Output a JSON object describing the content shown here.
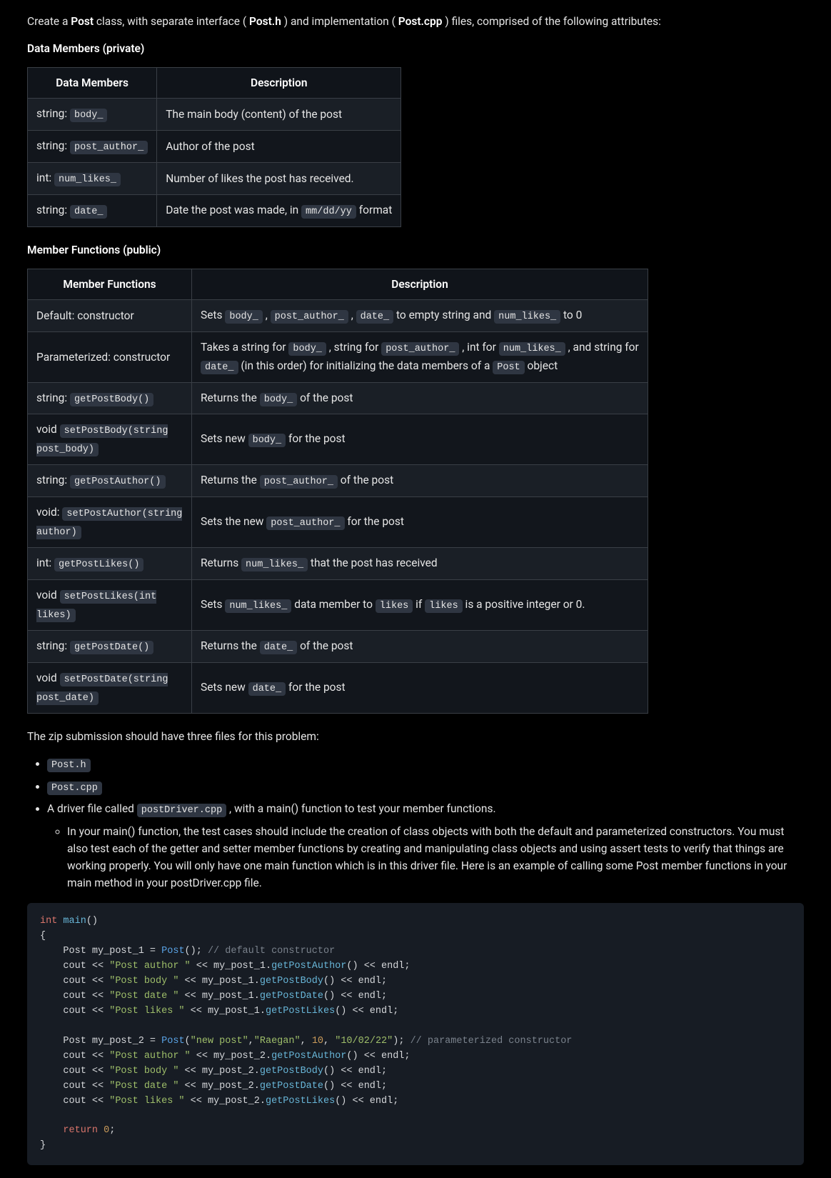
{
  "intro": {
    "t1": "Create a ",
    "t2": "Post",
    "t3": " class, with separate interface (",
    "t4": "Post.h",
    "t5": ") and implementation (",
    "t6": "Post.cpp",
    "t7": ") files, comprised of the following attributes:"
  },
  "dm_heading": "Data Members (private)",
  "dm_head": {
    "c1": "Data Members",
    "c2": "Description"
  },
  "dm": {
    "r0": {
      "p": "string: ",
      "c": "body_",
      "d": "The main body (content) of the post"
    },
    "r1": {
      "p": "string: ",
      "c": "post_author_",
      "d": "Author of the post"
    },
    "r2": {
      "p": "int: ",
      "c": "num_likes_",
      "d": "Number of likes the post has received."
    },
    "r3": {
      "p": "string: ",
      "c": "date_",
      "d1": "Date the post was made, in ",
      "dc": "mm/dd/yy",
      "d2": " format"
    }
  },
  "mf_heading": "Member Functions (public)",
  "mf_head": {
    "c1": "Member Functions",
    "c2": "Description"
  },
  "mf": {
    "r0": {
      "left": "Default: constructor",
      "d1": "Sets ",
      "c1": "body_",
      "d2": " , ",
      "c2": "post_author_",
      "d3": " , ",
      "c3": "date_",
      "d4": " to empty string and ",
      "c4": "num_likes_",
      "d5": " to 0"
    },
    "r1": {
      "left": "Parameterized: constructor",
      "d1": "Takes a string for ",
      "c1": "body_",
      "d2": " , string for ",
      "c2": "post_author_",
      "d3": " , int for ",
      "c3": "num_likes_",
      "d4": " , and string for ",
      "c4": "date_",
      "d5": " (in this order) for initializing the data members of a ",
      "c5": "Post",
      "d6": " object"
    },
    "r2": {
      "lp": "string: ",
      "lc": "getPostBody()",
      "d1": "Returns the ",
      "c1": "body_",
      "d2": " of the post"
    },
    "r3": {
      "lp": "void ",
      "lc": "setPostBody(string post_body)",
      "d1": "Sets new ",
      "c1": "body_",
      "d2": " for the post"
    },
    "r4": {
      "lp": "string: ",
      "lc": "getPostAuthor()",
      "d1": "Returns the ",
      "c1": "post_author_",
      "d2": " of the post"
    },
    "r5": {
      "lp": "void: ",
      "lc": "setPostAuthor(string author)",
      "d1": "Sets the new ",
      "c1": "post_author_",
      "d2": " for the post"
    },
    "r6": {
      "lp": "int: ",
      "lc": "getPostLikes()",
      "d1": "Returns ",
      "c1": "num_likes_",
      "d2": " that the post has received"
    },
    "r7": {
      "lp": "void ",
      "lc": "setPostLikes(int likes)",
      "d1": "Sets ",
      "c1": "num_likes_",
      "d2": " data member to ",
      "c2": "likes",
      "d3": " if ",
      "c3": "likes",
      "d4": " is a positive integer or 0."
    },
    "r8": {
      "lp": "string: ",
      "lc": "getPostDate()",
      "d1": "Returns the ",
      "c1": "date_",
      "d2": " of the post"
    },
    "r9": {
      "lp": "void ",
      "lc": "setPostDate(string post_date)",
      "d1": "Sets new ",
      "c1": "date_",
      "d2": " for the post"
    }
  },
  "zip_line": "The zip submission should have three files for this problem:",
  "files": {
    "f0": "Post.h",
    "f1": "Post.cpp",
    "f2_pre": "A driver file called ",
    "f2_code": "postDriver.cpp",
    "f2_post": " , with a main() function to test your member functions.",
    "sub": "In your main() function, the test cases should include the creation of class objects with both the default and parameterized constructors. You must also test each of the getter and setter member functions by creating and manipulating class objects and using assert tests to verify that things are working properly. You will only have one main function which is in this driver file. Here is an example of calling some Post member functions in your main method in your postDriver.cpp file."
  },
  "code": {
    "kw_int": "int",
    "fn_main": "main",
    "paren": "()",
    "ob": "{",
    "cb": "}",
    "decl1a": "    Post my_post_1 = ",
    "type_post": "Post",
    "decl1b": "(); ",
    "cmt1": "// default constructor",
    "cout_pre": "    cout << ",
    "s_author": "\"Post author \"",
    "s_body": "\"Post body \"",
    "s_date": "\"Post date \"",
    "s_likes": "\"Post likes \"",
    "mid1": " << my_post_1.",
    "mid2": " << my_post_2.",
    "getAuthor": "getPostAuthor",
    "getBody": "getPostBody",
    "getDate": "getPostDate",
    "getLikes": "getPostLikes",
    "tail": "() << endl;",
    "blank": "",
    "decl2a": "    Post my_post_2 = ",
    "decl2b": "(",
    "arg_s1": "\"new post\"",
    "comma": ",",
    "arg_s2": "\"Raegan\"",
    "sp": " ",
    "arg_n": "10",
    "arg_s3": "\"10/02/22\"",
    "decl2c": "); ",
    "cmt2": "// parameterized constructor",
    "ret_pre": "    ",
    "kw_return": "return",
    "ret_sp": " ",
    "num0": "0",
    "semi": ";"
  }
}
